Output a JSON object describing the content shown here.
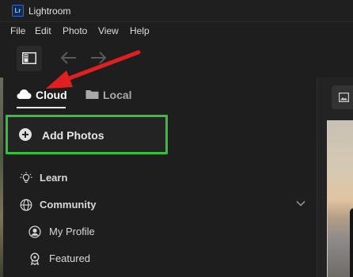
{
  "app": {
    "title": "Lightroom",
    "logo": "Lr"
  },
  "menu": [
    "File",
    "Edit",
    "Photo",
    "View",
    "Help"
  ],
  "tabs": [
    {
      "label": "Cloud",
      "icon": "cloud-icon",
      "active": true
    },
    {
      "label": "Local",
      "icon": "folder-icon",
      "active": false
    }
  ],
  "add_photos": {
    "label": "Add Photos"
  },
  "nav": {
    "learn": "Learn",
    "community": "Community",
    "my_profile": "My Profile",
    "featured": "Featured"
  },
  "colors": {
    "highlight_box": "#31c23a",
    "annotation_arrow": "#e02020",
    "background": "#1e1e1e"
  }
}
